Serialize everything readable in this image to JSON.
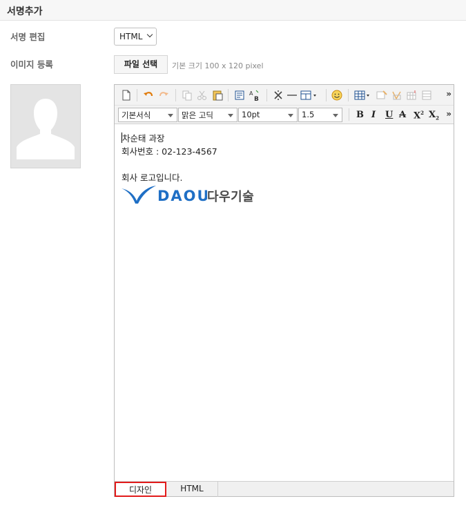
{
  "page": {
    "title": "서명추가"
  },
  "signature_edit": {
    "label": "서명 편집",
    "format_value": "HTML"
  },
  "image_register": {
    "label": "이미지 등록",
    "file_button": "파일 선택",
    "hint": "기본 크기 100 x 120 pixel"
  },
  "editor": {
    "toolbar": {
      "row1_icons": [
        "new-document-icon",
        "undo-icon",
        "redo-icon",
        "copy-icon",
        "cut-icon",
        "paste-icon",
        "paste-text-icon",
        "spellcheck-icon",
        "special-char-icon",
        "horizontal-line-icon",
        "insert-table-dropdown-icon",
        "emoticon-icon",
        "table-icon",
        "table-edit-icon",
        "table-style-icon",
        "table-cell-icon",
        "more-icon"
      ],
      "paragraph_style": "기본서식",
      "font_family": "맑은 고딕",
      "font_size": "10pt",
      "line_height": "1.5",
      "format_buttons": {
        "bold": "B",
        "italic": "I",
        "underline": "U",
        "strike": "A",
        "superscript": "X",
        "subscript": "X"
      },
      "more": "»"
    },
    "content": {
      "line1": "차순태 과장",
      "line2": "회사번호 : 02-123-4567",
      "line3": "회사 로고입니다.",
      "logo_text_en": "DAOU",
      "logo_text_ko": "다우기술"
    },
    "tabs": {
      "design": "디자인",
      "html": "HTML"
    },
    "colors": {
      "accent_tab_border": "#e21a1a",
      "logo_blue": "#1f6fc5"
    }
  }
}
